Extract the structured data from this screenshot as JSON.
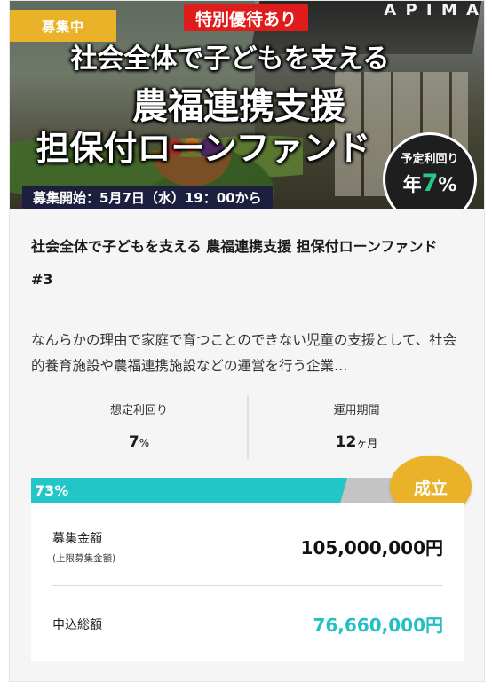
{
  "hero": {
    "status_badge": "募集中",
    "special_badge": "特別優待あり",
    "logo_text": "A P I M A",
    "headline_1": "社会全体で子どもを支える",
    "headline_2": "農福連携支援",
    "headline_3": "担保付ローンファンド",
    "start_text": "募集開始：5月7日（水）19：00から",
    "yield_label": "予定利回り",
    "yield_prefix": "年",
    "yield_number": "7",
    "yield_suffix": "%"
  },
  "fund": {
    "title": "社会全体で子どもを支える 農福連携支援 担保付ローンファンド#3",
    "description": "なんらかの理由で家庭で育つことのできない児童の支援として、社会的養育施設や農福連携施設などの運営を行う企業…"
  },
  "stats": {
    "yield_label": "想定利回り",
    "yield_value": "7",
    "yield_unit": "%",
    "period_label": "運用期間",
    "period_value": "12",
    "period_unit": "ヶ月"
  },
  "progress": {
    "percent": 73,
    "label": "73%",
    "badge": "成立"
  },
  "amounts": {
    "target_label": "募集金額",
    "target_sub": "(上限募集金額)",
    "target_value": "105,000,000円",
    "applied_label": "申込総額",
    "applied_value": "76,660,000円"
  },
  "colors": {
    "accent_gold": "#eab228",
    "progress_teal": "#22c6c8",
    "special_red": "#e01b1b",
    "yield_green": "#2bc58a"
  }
}
